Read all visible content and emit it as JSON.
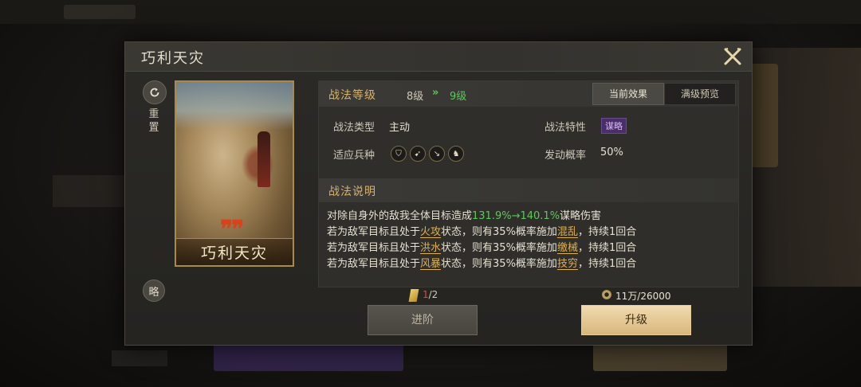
{
  "dialog": {
    "title": "巧利天灾",
    "close_icon": "close-x-icon"
  },
  "left": {
    "reset_label": "重置",
    "strategy_label": "略"
  },
  "card": {
    "quote_mark": "“",
    "name": "巧利天灾"
  },
  "level": {
    "label": "战法等级",
    "current": "8级",
    "arrow": "»",
    "next": "9级"
  },
  "tabs": {
    "current": "当前效果",
    "preview": "满级预览"
  },
  "info": {
    "type_label": "战法类型",
    "type_value": "主动",
    "trait_label": "战法特性",
    "trait_value": "谋略",
    "troop_label": "适应兵种",
    "troops": [
      "shield-icon",
      "bow-icon",
      "spear-icon",
      "horse-icon"
    ],
    "chance_label": "发动概率",
    "chance_value": "50%"
  },
  "description": {
    "title": "战法说明",
    "line1": {
      "pre": "对除自身外的敌我全体目标造成",
      "num": "131.9%→140.1%",
      "post": "谋略伤害"
    },
    "line2": {
      "pre": "若为敌军目标且处于",
      "kw1": "火攻",
      "mid": "状态，则有35%概率施加",
      "kw2": "混乱",
      "post": "，持续1回合"
    },
    "line3": {
      "pre": "若为敌军目标且处于",
      "kw1": "洪水",
      "mid": "状态，则有35%概率施加",
      "kw2": "缴械",
      "post": "，持续1回合"
    },
    "line4": {
      "pre": "若为敌军目标且处于",
      "kw1": "风暴",
      "mid": "状态，则有35%概率施加",
      "kw2": "技穷",
      "post": "，持续1回合"
    }
  },
  "bottom": {
    "token_current": "1",
    "token_total": "/2",
    "coin_text": "11万/26000",
    "advance_label": "进阶",
    "upgrade_label": "升级"
  },
  "colors": {
    "gold": "#d7b36a",
    "green": "#5cc85c",
    "keyword": "#e2b04a",
    "purple_badge": "#4a2e6a"
  }
}
